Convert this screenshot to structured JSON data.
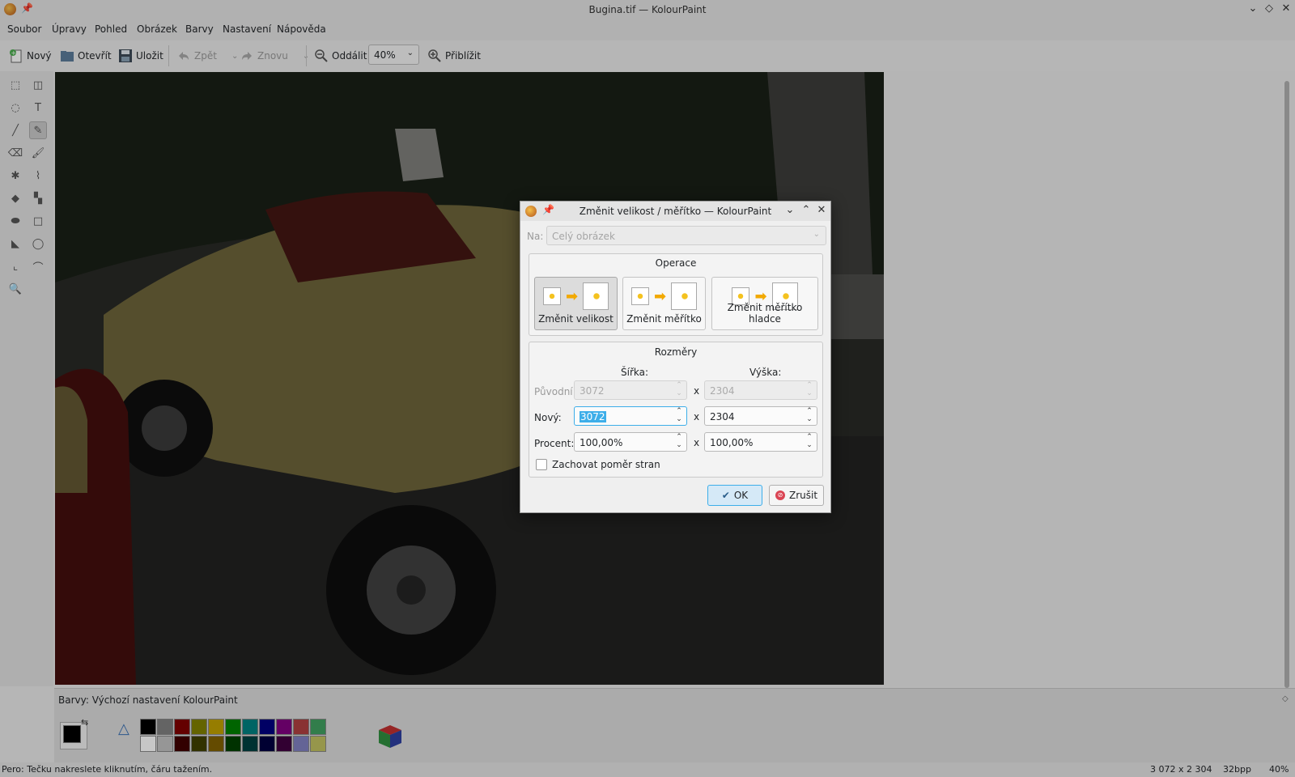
{
  "window": {
    "title": "Bugina.tif — KolourPaint"
  },
  "menubar": {
    "items": [
      "Soubor",
      "Úpravy",
      "Pohled",
      "Obrázek",
      "Barvy",
      "Nastavení",
      "Nápověda"
    ]
  },
  "toolbar": {
    "new_label": "Nový",
    "open_label": "Otevřít",
    "save_label": "Uložit",
    "undo_label": "Zpět",
    "redo_label": "Znovu",
    "zoom_out_label": "Oddálit",
    "zoom_value": "40%",
    "zoom_in_label": "Přiblížit"
  },
  "dialog": {
    "title": "Změnit velikost / měřítko — KolourPaint",
    "target_label": "Na:",
    "target_value": "Celý obrázek",
    "operation_group_title": "Operace",
    "operations": [
      {
        "label": "Změnit velikost",
        "selected": true
      },
      {
        "label": "Změnit měřítko",
        "selected": false
      },
      {
        "label": "Změnit měřítko hladce",
        "selected": false
      }
    ],
    "dimensions_group_title": "Rozměry",
    "width_header": "Šířka:",
    "height_header": "Výška:",
    "original_label": "Původní:",
    "original_width": "3072",
    "original_height": "2304",
    "new_label": "Nový:",
    "new_width": "3072",
    "new_height": "2304",
    "percent_label": "Procent:",
    "percent_width": "100,00%",
    "percent_height": "100,00%",
    "x_separator": "x",
    "keep_aspect_label": "Zachovat poměr stran",
    "keep_aspect_checked": false,
    "ok_label": "OK",
    "cancel_label": "Zrušit"
  },
  "palette": {
    "title": "Barvy: Výchozí nastavení KolourPaint",
    "foreground": "#000000",
    "background": "#ffffff",
    "row1": [
      "#000000",
      "#808080",
      "#800000",
      "#808000",
      "#c0a000",
      "#008000",
      "#008080",
      "#000080",
      "#800080",
      "#b04040",
      "#40a060"
    ],
    "row2": [
      "#ffffff",
      "#c0c0c0",
      "#400000",
      "#404000",
      "#806000",
      "#004000",
      "#004040",
      "#000040",
      "#400040",
      "#8080c0",
      "#c0c060"
    ]
  },
  "statusbar": {
    "message": "Pero: Tečku nakreslete kliknutím, čáru tažením.",
    "image_size": "3 072 x 2 304",
    "depth": "32bpp",
    "zoom": "40%"
  }
}
